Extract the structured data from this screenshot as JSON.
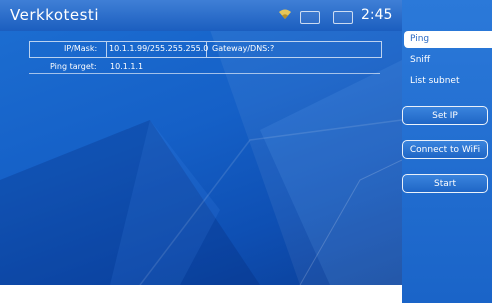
{
  "app": {
    "title": "Verkkotesti"
  },
  "status": {
    "time": "2:45"
  },
  "info": {
    "ip_label": "IP/Mask:",
    "ip_value": "10.1.1.99/255.255.255.0",
    "gateway_label": "Gateway/DNS:",
    "gateway_value": "?",
    "ping_label": "Ping target:",
    "ping_value": "10.1.1.1"
  },
  "sidebar": {
    "tabs": [
      {
        "label": "Ping"
      },
      {
        "label": "Sniff"
      },
      {
        "label": "List subnet"
      }
    ],
    "buttons": {
      "set_ip": "Set IP",
      "connect_wifi": "Connect to WiFi",
      "start": "Start"
    }
  },
  "icons": {
    "wifi": "wifi-icon"
  },
  "colors": {
    "background": "#1560c7",
    "titlebar": "#2a6ac4",
    "active_tab_bg": "#ffffff",
    "text": "#ffffff"
  }
}
